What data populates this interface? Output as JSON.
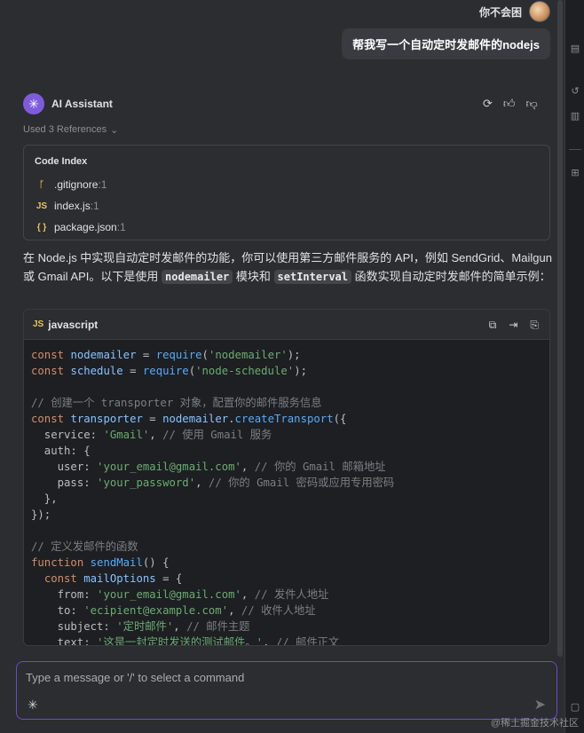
{
  "user": {
    "name": "你不会困",
    "message": "帮我写一个自动定时发邮件的nodejs"
  },
  "assistant": {
    "name": "AI Assistant",
    "references_label": "Used 3 References",
    "actions": [
      "refresh-icon",
      "thumbs-up-icon",
      "thumbs-down-icon"
    ]
  },
  "references": {
    "title": "Code Index",
    "items": [
      {
        "icon": "git-icon",
        "glyph": "ᚴ",
        "name": ".gitignore",
        "line": ":1"
      },
      {
        "icon": "js-file-icon",
        "glyph": "JS",
        "name": "index.js",
        "line": ":1"
      },
      {
        "icon": "json-file-icon",
        "glyph": "{ }",
        "name": "package.json",
        "line": ":1"
      }
    ]
  },
  "answer": {
    "p1": "在 Node.js 中实现自动定时发邮件的功能，你可以使用第三方邮件服务的 API，例如 SendGrid、Mailgun 或 Gmail API。以下是使用 ",
    "code1": "nodemailer",
    "p2": " 模块和 ",
    "code2": "setInterval",
    "p3": " 函数实现自动定时发邮件的简单示例："
  },
  "code_block": {
    "language_icon": "JS",
    "language": "javascript",
    "actions": [
      "copy-icon",
      "insert-icon",
      "new-file-icon"
    ]
  },
  "input": {
    "placeholder": "Type a message or '/' to select a command"
  },
  "watermark": "@稀土掘金技术社区",
  "colors": {
    "background": "#2b2d30",
    "accent": "#7f5bdc",
    "input_border": "#6a4bd0",
    "code_bg": "#1e1f22"
  }
}
